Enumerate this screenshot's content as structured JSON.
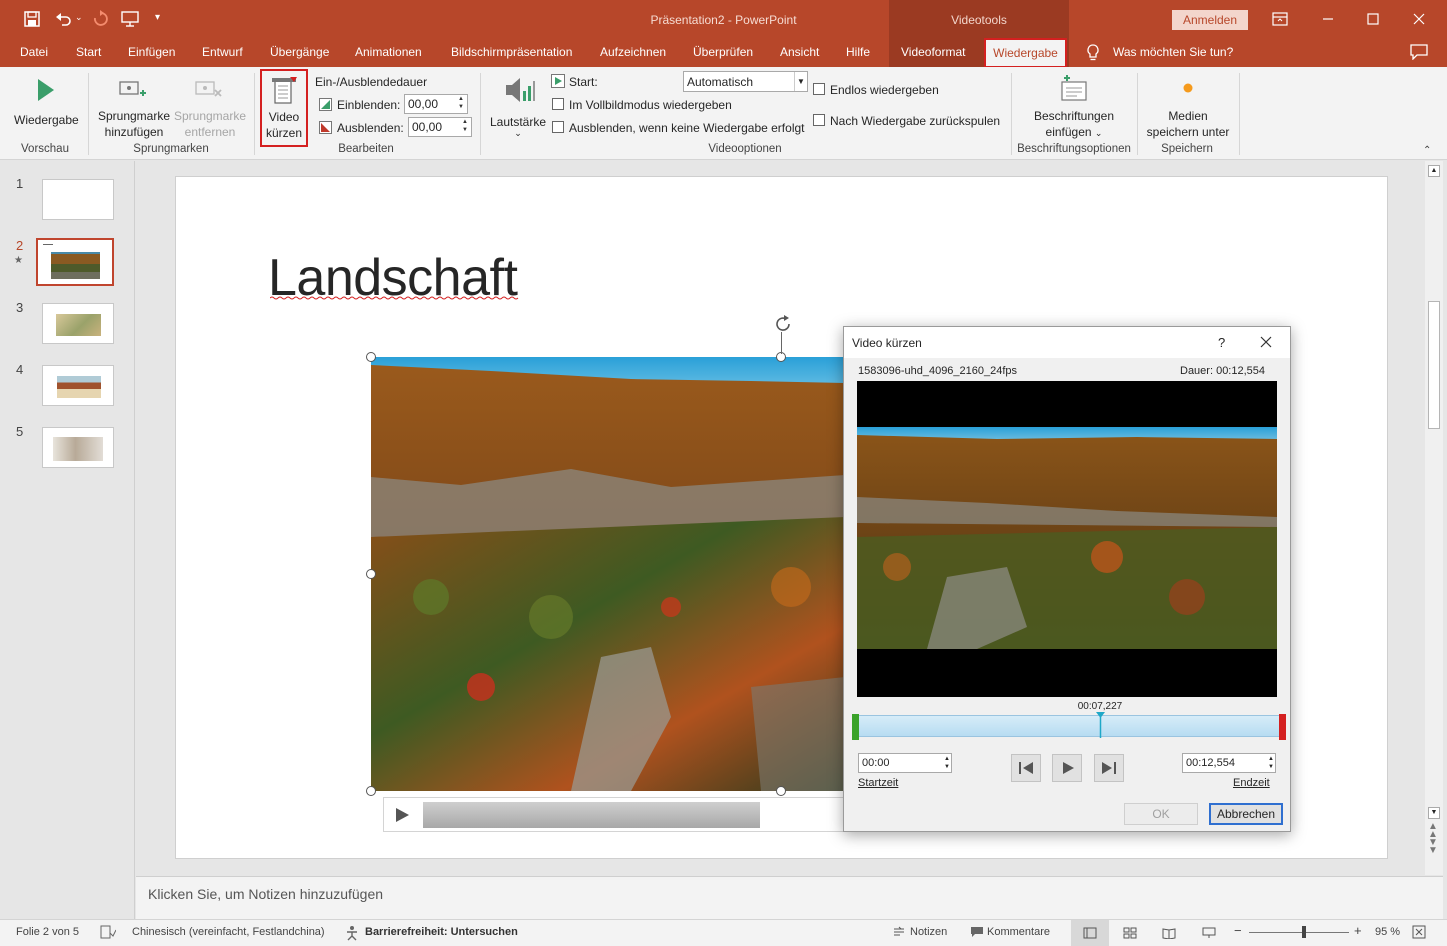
{
  "window": {
    "title": "Präsentation2  -  PowerPoint",
    "context_tab_group": "Videotools",
    "sign_in": "Anmelden"
  },
  "menu": {
    "tabs": [
      "Datei",
      "Start",
      "Einfügen",
      "Entwurf",
      "Übergänge",
      "Animationen",
      "Bildschirmpräsentation",
      "Aufzeichnen",
      "Überprüfen",
      "Ansicht",
      "Hilfe",
      "Videoformat",
      "Wiedergabe"
    ],
    "active_tab": "Wiedergabe",
    "tell_me": "Was möchten Sie tun?"
  },
  "ribbon": {
    "vorschau": {
      "play_label": "Wiedergabe",
      "group": "Vorschau"
    },
    "sprungmarken": {
      "add_line1": "Sprungmarke",
      "add_line2": "hinzufügen",
      "remove_line1": "Sprungmarke",
      "remove_line2": "entfernen",
      "group": "Sprungmarken"
    },
    "bearbeiten": {
      "trim_line1": "Video",
      "trim_line2": "kürzen",
      "fade_title": "Ein-/Ausblendedauer",
      "fade_in_label": "Einblenden:",
      "fade_in_value": "00,00",
      "fade_out_label": "Ausblenden:",
      "fade_out_value": "00,00",
      "group": "Bearbeiten"
    },
    "videooptionen": {
      "volume": "Lautstärke",
      "start_label": "Start:",
      "start_value": "Automatisch",
      "fullscreen": "Im Vollbildmodus wiedergeben",
      "hide": "Ausblenden, wenn keine Wiedergabe erfolgt",
      "loop": "Endlos wiedergeben",
      "rewind": "Nach Wiedergabe zurückspulen",
      "group": "Videooptionen"
    },
    "beschriftung": {
      "line1": "Beschriftungen",
      "line2": "einfügen",
      "group": "Beschriftungsoptionen"
    },
    "speichern": {
      "line1": "Medien",
      "line2": "speichern unter",
      "group": "Speichern"
    }
  },
  "slides": {
    "numbers": [
      "1",
      "2",
      "3",
      "4",
      "5"
    ],
    "active_index": 1,
    "star": "★"
  },
  "slide": {
    "title": "Landschaft"
  },
  "notes": {
    "placeholder": "Klicken Sie, um Notizen hinzuzufügen"
  },
  "dialog": {
    "title": "Video kürzen",
    "help": "?",
    "filename": "1583096-uhd_4096_2160_24fps",
    "duration": "Dauer: 00:12,554",
    "playhead_time": "00:07,227",
    "playhead_fraction": 0.576,
    "start_value": "00:00",
    "start_label": "Startzeit",
    "end_value": "00:12,554",
    "end_label": "Endzeit",
    "ok": "OK",
    "cancel": "Abbrechen"
  },
  "status": {
    "slide_info": "Folie 2 von 5",
    "language": "Chinesisch (vereinfacht, Festlandchina)",
    "accessibility": "Barrierefreiheit: Untersuchen",
    "notes": "Notizen",
    "comments": "Kommentare",
    "zoom": "95 %",
    "zoom_fraction": 0.55
  },
  "colors": {
    "accent": "#b7472a",
    "active_outline": "#d42020"
  }
}
